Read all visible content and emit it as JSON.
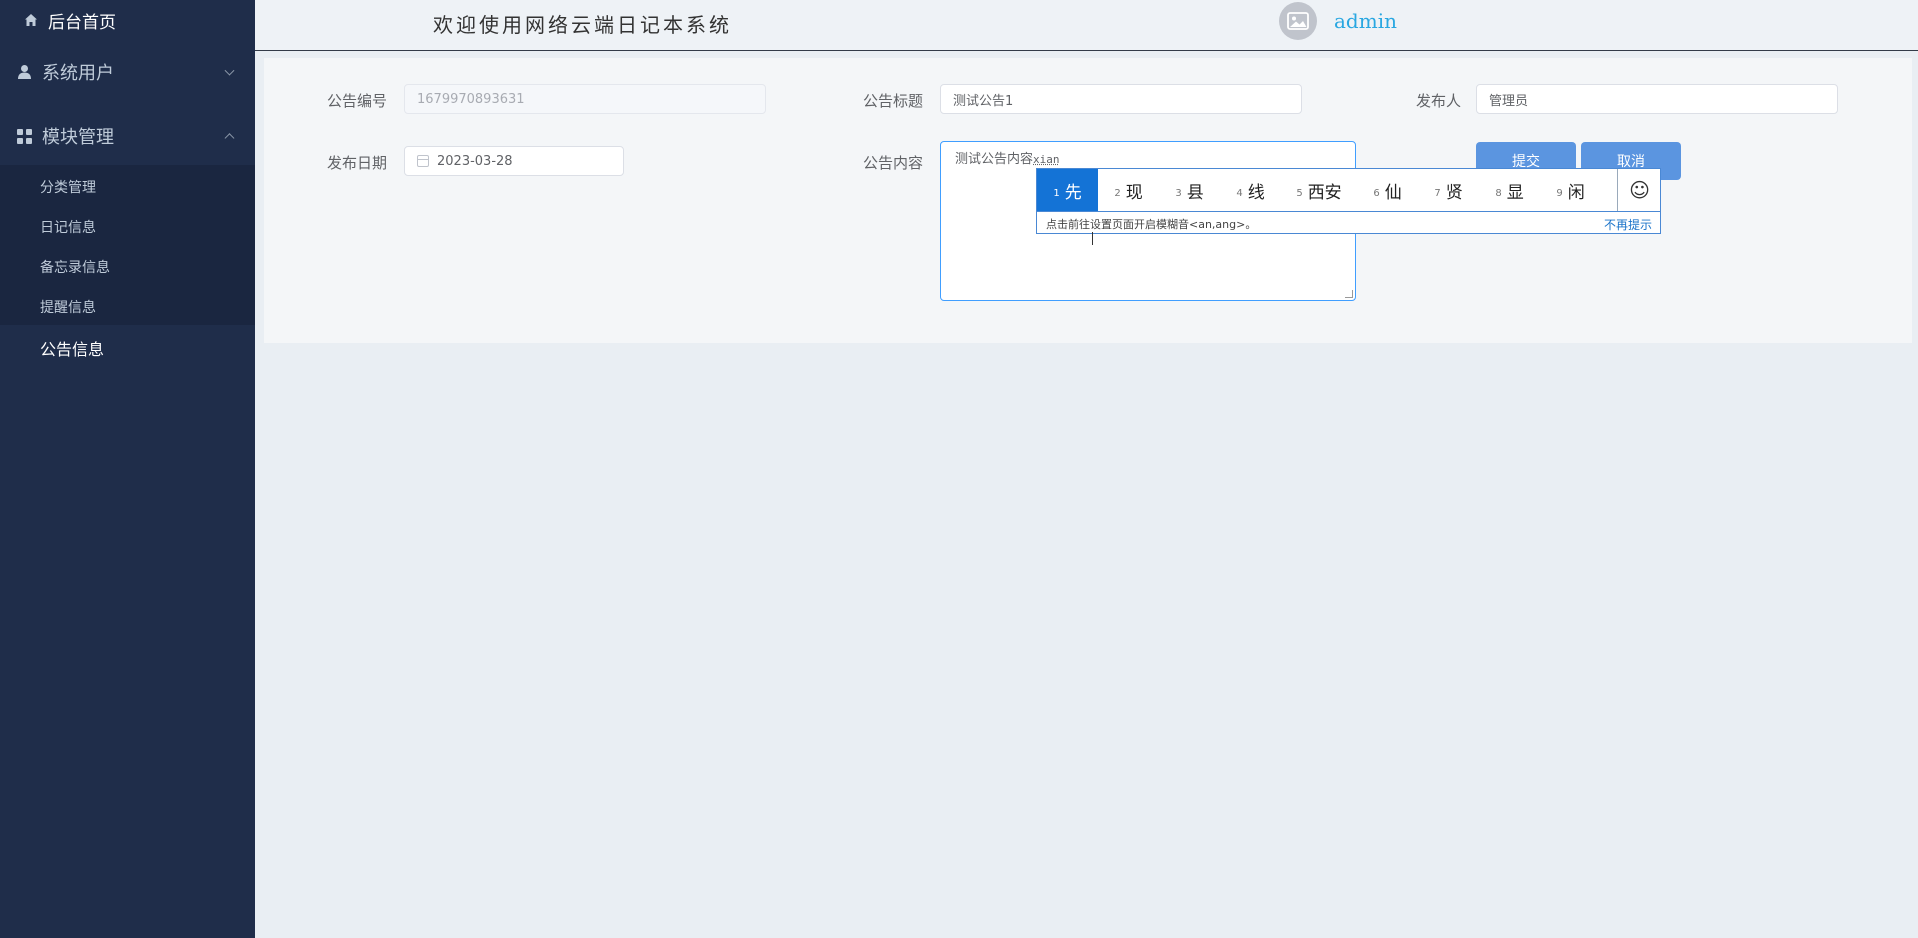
{
  "sidebar": {
    "home": "后台首页",
    "users": "系统用户",
    "modules": "模块管理",
    "sub_items": [
      "分类管理",
      "日记信息",
      "备忘录信息",
      "提醒信息"
    ],
    "notice": "公告信息"
  },
  "header": {
    "welcome": "欢迎使用网络云端日记本系统",
    "username": "admin"
  },
  "form": {
    "id_label": "公告编号",
    "id_value": "1679970893631",
    "title_label": "公告标题",
    "title_value": "测试公告1",
    "publisher_label": "发布人",
    "publisher_value": "管理员",
    "date_label": "发布日期",
    "date_value": "2023-03-28",
    "content_label": "公告内容",
    "content_value": "测试公告内容",
    "content_composing": "xian",
    "submit": "提交",
    "cancel": "取消"
  },
  "ime": {
    "candidates": [
      {
        "num": "1",
        "text": "先"
      },
      {
        "num": "2",
        "text": "现"
      },
      {
        "num": "3",
        "text": "县"
      },
      {
        "num": "4",
        "text": "线"
      },
      {
        "num": "5",
        "text": "西安"
      },
      {
        "num": "6",
        "text": "仙"
      },
      {
        "num": "7",
        "text": "贤"
      },
      {
        "num": "8",
        "text": "显"
      },
      {
        "num": "9",
        "text": "闲"
      }
    ],
    "hint": "点击前往设置页面开启模糊音<an,ang>。",
    "dismiss": "不再提示"
  }
}
